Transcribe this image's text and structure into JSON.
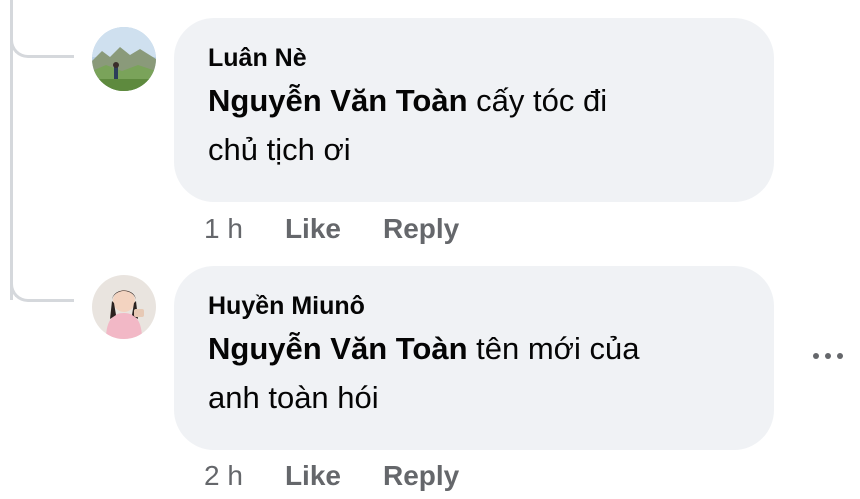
{
  "comments": [
    {
      "author": "Luân Nè",
      "mention": "Nguyễn Văn Toàn",
      "text_line1": " cấy tóc đi",
      "text_line2": "chủ tịch ơi",
      "time": "1 h",
      "like_label": "Like",
      "reply_label": "Reply",
      "avatar_icon": "landscape-photo-avatar"
    },
    {
      "author": "Huyền Miunô",
      "mention": "Nguyễn Văn Toàn",
      "text_line1": " tên mới của",
      "text_line2": "anh toàn hói",
      "time": "2 h",
      "like_label": "Like",
      "reply_label": "Reply",
      "avatar_icon": "person-photo-avatar",
      "more_icon": "more-options-icon"
    }
  ],
  "colors": {
    "bubble_bg": "#f0f2f5",
    "text": "#050505",
    "secondary": "#65676b",
    "thread_line": "#d5d8dc"
  }
}
